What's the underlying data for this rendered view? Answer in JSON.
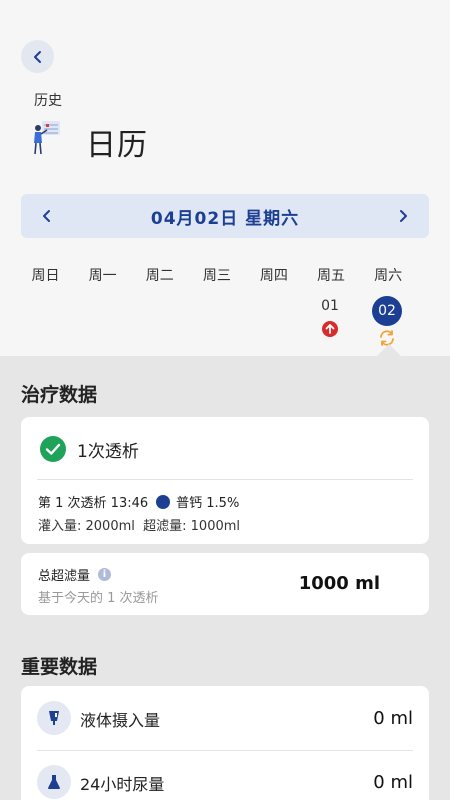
{
  "header": {
    "breadcrumb": "历史",
    "title": "日历"
  },
  "date_nav": {
    "label": "04月02日 星期六"
  },
  "weekdays": [
    "周日",
    "周一",
    "周二",
    "周三",
    "周四",
    "周五",
    "周六"
  ],
  "days": {
    "friday": {
      "num": "01",
      "marker": "arrow-up-red-icon"
    },
    "saturday": {
      "num": "02",
      "marker": "sync-orange-icon",
      "selected": true
    }
  },
  "treatment": {
    "section_title": "治疗数据",
    "session_count": "1次透析",
    "session_prefix": "第 1 次透析 13:46",
    "solution": "普钙 1.5%",
    "fill_line": "灌入量: 2000ml  超滤量: 1000ml",
    "uf_total_label": "总超滤量",
    "uf_total_sub": "基于今天的 1 次透析",
    "uf_total_value": "1000 ml"
  },
  "important": {
    "section_title": "重要数据",
    "rows": [
      {
        "label": "液体摄入量",
        "value": "0 ml",
        "icon": "drink-icon"
      },
      {
        "label": "24小时尿量",
        "value": "0 ml",
        "icon": "flask-icon"
      }
    ]
  },
  "colors": {
    "accent": "#1c3f93",
    "success": "#1fa35b",
    "alert": "#d92b2b",
    "sync": "#f2a233"
  }
}
